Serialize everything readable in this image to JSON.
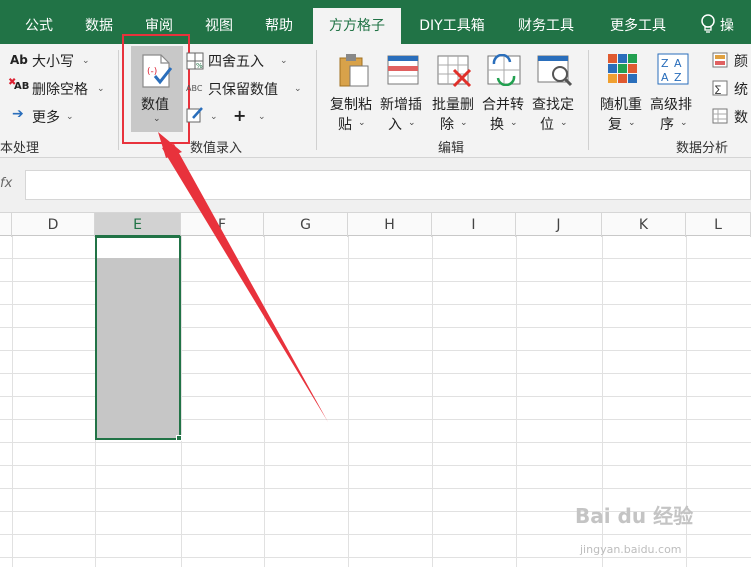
{
  "tabs": [
    {
      "label": "公式",
      "active": false
    },
    {
      "label": "数据",
      "active": false
    },
    {
      "label": "审阅",
      "active": false
    },
    {
      "label": "视图",
      "active": false
    },
    {
      "label": "帮助",
      "active": false
    },
    {
      "label": "方方格子",
      "active": true
    },
    {
      "label": "DIY工具箱",
      "active": false
    },
    {
      "label": "财务工具",
      "active": false
    },
    {
      "label": "更多工具",
      "active": false
    },
    {
      "label": "操",
      "active": false
    }
  ],
  "ribbon": {
    "text_group": {
      "case_label": "大小写",
      "case_icon_text": "Ab",
      "remove_spaces_label": "删除空格",
      "remove_spaces_icon_text": "AB",
      "more_label": "更多",
      "group_label": "本处理"
    },
    "value_group": {
      "value_label": "数值",
      "round_label": "四舍五入",
      "keep_value_label": "只保留数值",
      "keep_value_icon_text": "ABC",
      "group_label": "数值录入"
    },
    "edit_group": {
      "copy_paste_label": [
        "复制粘",
        "贴"
      ],
      "new_insert_label": [
        "新增插",
        "入"
      ],
      "batch_delete_label": [
        "批量删",
        "除"
      ],
      "merge_convert_label": [
        "合并转",
        "换"
      ],
      "find_locate_label": [
        "查找定",
        "位"
      ],
      "group_label": "编辑"
    },
    "analysis_group": {
      "random_dup_label": [
        "随机重",
        "复"
      ],
      "advanced_sort_label": [
        "高级排",
        "序"
      ],
      "color_label": "颜",
      "stats_label": "统",
      "data_label": "数",
      "group_label": "数据分析"
    }
  },
  "formula_bar": {
    "fx_label": "fx",
    "value": ""
  },
  "columns": [
    {
      "name": "D",
      "selected": false
    },
    {
      "name": "E",
      "selected": true
    },
    {
      "name": "F",
      "selected": false
    },
    {
      "name": "G",
      "selected": false
    },
    {
      "name": "H",
      "selected": false
    },
    {
      "name": "I",
      "selected": false
    },
    {
      "name": "J",
      "selected": false
    },
    {
      "name": "K",
      "selected": false
    },
    {
      "name": "L",
      "selected": false
    }
  ],
  "watermark": {
    "text": "Bai du 经验",
    "url": "jingyan.baidu.com"
  },
  "colors": {
    "accent": "#217346",
    "highlight": "#e8323c"
  }
}
